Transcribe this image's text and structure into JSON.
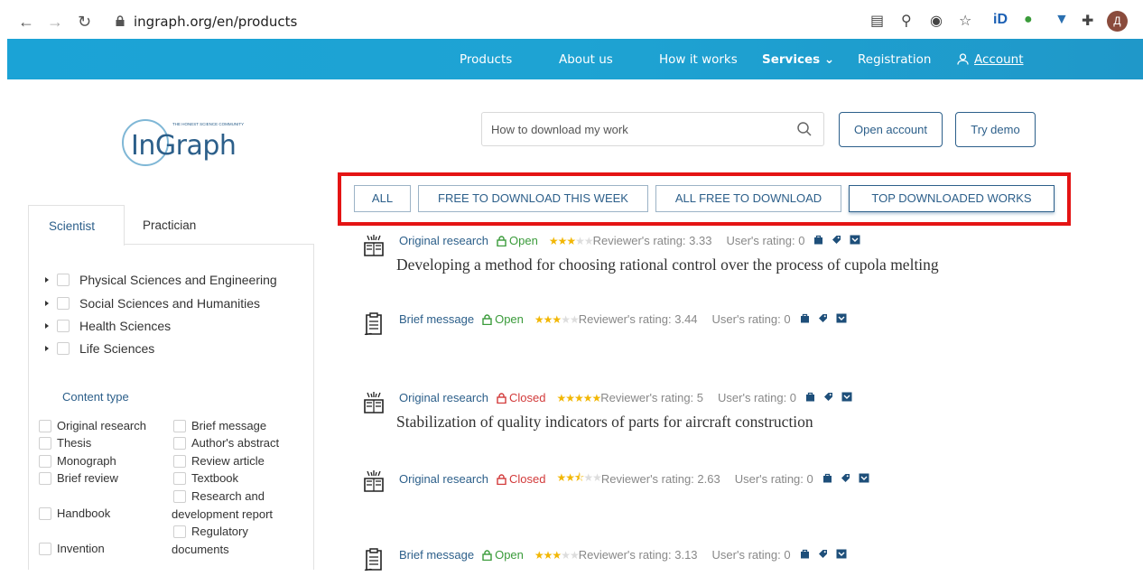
{
  "browser": {
    "url": "ingraph.org/en/products",
    "profile_initial": "Д"
  },
  "nav": {
    "products": "Products",
    "about": "About us",
    "how": "How it works",
    "services": "Services",
    "registration": "Registration",
    "account": "Account"
  },
  "logo": {
    "text": "InGraph",
    "tagline": "THE HONEST SCIENCE COMMUNITY"
  },
  "search": {
    "value": "How to download my work"
  },
  "header_buttons": {
    "open_account": "Open account",
    "try_demo": "Try demo"
  },
  "filter_tabs": [
    {
      "label": "ALL"
    },
    {
      "label": "FREE TO DOWNLOAD THIS WEEK"
    },
    {
      "label": "ALL FREE TO DOWNLOAD"
    },
    {
      "label": "TOP DOWNLOADED WORKS"
    }
  ],
  "sidebar": {
    "tabs": [
      "Scientist",
      "Practician"
    ],
    "tree": [
      "Physical Sciences and Engineering",
      "Social Sciences and Humanities",
      "Health Sciences",
      "Life Sciences"
    ],
    "content_type_title": "Content type",
    "content_types": [
      "Original research",
      "Thesis",
      "Monograph",
      "Brief review",
      "Handbook",
      "Invention",
      "Brief message",
      "Author's abstract",
      "Review article",
      "Textbook",
      "Research and development report",
      "Regulatory documents"
    ]
  },
  "results": [
    {
      "type": "Original research",
      "access": "Open",
      "reviewer_rating": "Reviewer's rating: 3.33",
      "stars": 3,
      "users_rating": "User's rating: 0",
      "title": "Developing a method for choosing rational control over the process of cupola melting"
    },
    {
      "type": "Brief message",
      "access": "Open",
      "reviewer_rating": "Reviewer's rating: 3.44",
      "stars": 3,
      "users_rating": "User's rating: 0",
      "title": ""
    },
    {
      "type": "Original research",
      "access": "Closed",
      "reviewer_rating": "Reviewer's rating: 5",
      "stars": 5,
      "users_rating": "User's rating: 0",
      "title": "Stabilization of quality indicators of parts for aircraft construction"
    },
    {
      "type": "Original research",
      "access": "Closed",
      "reviewer_rating": "Reviewer's rating: 2.63",
      "stars": 2.5,
      "users_rating": "User's rating: 0",
      "title": ""
    },
    {
      "type": "Brief message",
      "access": "Open",
      "reviewer_rating": "Reviewer's rating: 3.13",
      "stars": 3,
      "users_rating": "User's rating: 0",
      "title": ""
    }
  ],
  "colors": {
    "brand": "#2c5f8a",
    "nav_bg": "#1ba3d6",
    "highlight": "#e41414",
    "open": "#3a9b3a",
    "closed": "#d23a3a",
    "star": "#f2b705"
  }
}
